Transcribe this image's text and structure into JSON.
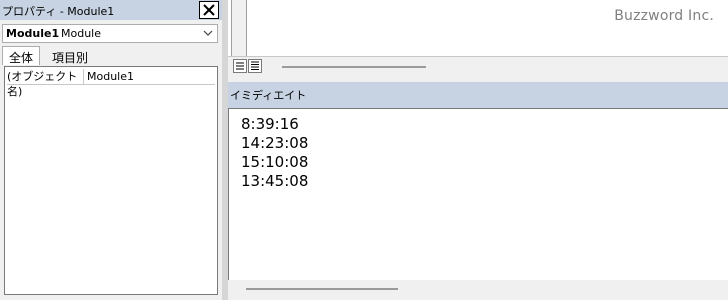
{
  "properties": {
    "title": "プロパティ - Module1",
    "object_name": "Module1",
    "object_type": "Module",
    "tabs": [
      {
        "label": "全体",
        "active": true
      },
      {
        "label": "項目別",
        "active": false
      }
    ],
    "rows": [
      {
        "name": "(オブジェクト名)",
        "value": "Module1"
      }
    ]
  },
  "immediate": {
    "title": "イミディエイト",
    "lines": [
      "8:39:16",
      "14:23:08",
      "15:10:08",
      "13:45:08"
    ]
  },
  "watermark": "Buzzword Inc.",
  "icons": {
    "close": "close-icon",
    "dropdown": "chevron-down-icon",
    "procedure_view": "procedure-view-icon",
    "full_module_view": "full-module-view-icon"
  },
  "colors": {
    "title_bar": "#c7d3e3",
    "background": "#f0f0f0"
  }
}
